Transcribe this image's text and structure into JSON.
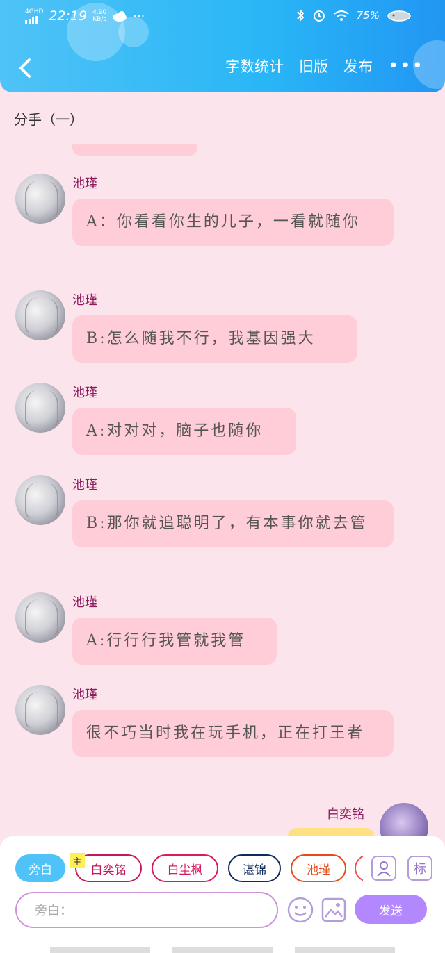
{
  "status_bar": {
    "signal": "4GHD",
    "time": "22:19",
    "net_speed_value": "4.90",
    "net_speed_unit": "KB/s",
    "dots": "···",
    "battery": "75%"
  },
  "nav": {
    "word_count": "字数统计",
    "old_version": "旧版",
    "publish": "发布",
    "more": "•••"
  },
  "chapter_title": "分手（一）",
  "messages": [
    {
      "sender": "池瑾",
      "text": "A：你看看你生的儿子，一看就随你"
    },
    {
      "sender": "池瑾",
      "text": "B:怎么随我不行，我基因强大"
    },
    {
      "sender": "池瑾",
      "text": "A:对对对，脑子也随你"
    },
    {
      "sender": "池瑾",
      "text": "B:那你就追聪明了，有本事你就去管"
    },
    {
      "sender": "池瑾",
      "text": "A:行行行我管就我管"
    },
    {
      "sender": "池瑾",
      "text": "很不巧当时我在玩手机，正在打王者"
    }
  ],
  "me": {
    "name": "白奕铭"
  },
  "roles": {
    "narration": "旁白",
    "main_tag": "主",
    "r1": "白奕铭",
    "r2": "白尘枫",
    "r3": "谌锦",
    "r4": "池瑾"
  },
  "tools": {
    "mark_label": "标"
  },
  "input": {
    "placeholder": "旁白："
  },
  "send_label": "发送"
}
